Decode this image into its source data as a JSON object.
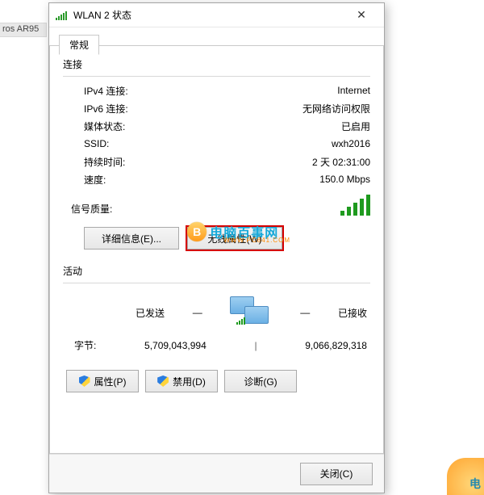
{
  "bg_text": "ros AR95",
  "window": {
    "title": "WLAN 2 状态",
    "close_glyph": "✕"
  },
  "tabs": {
    "general": "常规"
  },
  "connection": {
    "section_label": "连接",
    "rows": {
      "ipv4": {
        "label": "IPv4 连接:",
        "value": "Internet"
      },
      "ipv6": {
        "label": "IPv6 连接:",
        "value": "无网络访问权限"
      },
      "media": {
        "label": "媒体状态:",
        "value": "已启用"
      },
      "ssid": {
        "label": "SSID:",
        "value": "wxh2016"
      },
      "duration": {
        "label": "持续时间:",
        "value": "2 天 02:31:00"
      },
      "speed": {
        "label": "速度:",
        "value": "150.0 Mbps"
      }
    },
    "signal_label": "信号质量:"
  },
  "buttons": {
    "details": "详细信息(E)...",
    "wireless_props": "无线属性(W)",
    "properties": "属性(P)",
    "disable": "禁用(D)",
    "diagnose": "诊断(G)",
    "close": "关闭(C)"
  },
  "activity": {
    "section_label": "活动",
    "sent_label": "已发送",
    "received_label": "已接收",
    "separator": "—",
    "bytes_label": "字节:",
    "sent_value": "5,709,043,994",
    "divider": "|",
    "received_value": "9,066,829,318"
  },
  "watermark": {
    "badge": "B",
    "text1": "电脑百事网",
    "text2": "WWW.PC841.COM",
    "corner": "电"
  }
}
